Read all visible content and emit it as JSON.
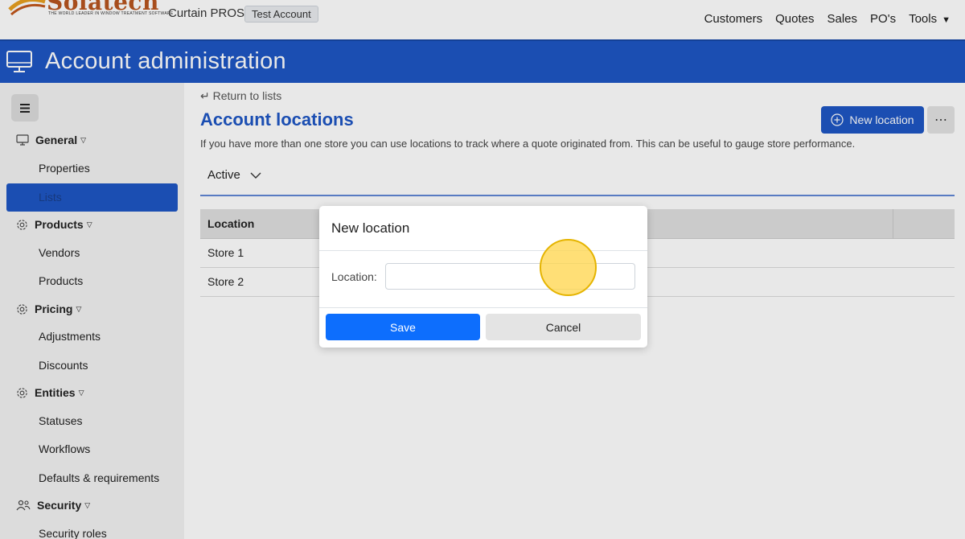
{
  "topbar": {
    "logo_text": "Solatech",
    "logo_tagline": "THE WORLD LEADER IN WINDOW TREATMENT SOFTWARE",
    "app_name": "Curtain PROS",
    "account_badge": "Test Account",
    "nav": [
      "Customers",
      "Quotes",
      "Sales",
      "PO's",
      "Tools"
    ]
  },
  "header": {
    "title": "Account administration"
  },
  "sidebar": {
    "sections": [
      {
        "label": "General",
        "items": [
          "Properties",
          "Lists"
        ]
      },
      {
        "label": "Products",
        "items": [
          "Vendors",
          "Products"
        ]
      },
      {
        "label": "Pricing",
        "items": [
          "Adjustments",
          "Discounts"
        ]
      },
      {
        "label": "Entities",
        "items": [
          "Statuses",
          "Workflows",
          "Defaults & requirements"
        ]
      },
      {
        "label": "Security",
        "items": [
          "Security roles"
        ]
      }
    ],
    "active_item": "Lists"
  },
  "main": {
    "return_link": "Return to lists",
    "title": "Account locations",
    "description": "If you have more than one store you can use locations to track where a quote originated from. This can be useful to gauge store performance.",
    "new_button": "New location",
    "more_button": "⋯",
    "filter": "Active",
    "table": {
      "columns": [
        "Location"
      ],
      "rows": [
        "Store 1",
        "Store 2"
      ]
    }
  },
  "modal": {
    "title": "New location",
    "field_label": "Location:",
    "field_value": "",
    "save": "Save",
    "cancel": "Cancel"
  },
  "colors": {
    "brand_blue": "#1e56c4",
    "primary_button": "#0d6efd",
    "sidebar_bg": "#f2f2f2",
    "click_marker": "#ffd650"
  }
}
